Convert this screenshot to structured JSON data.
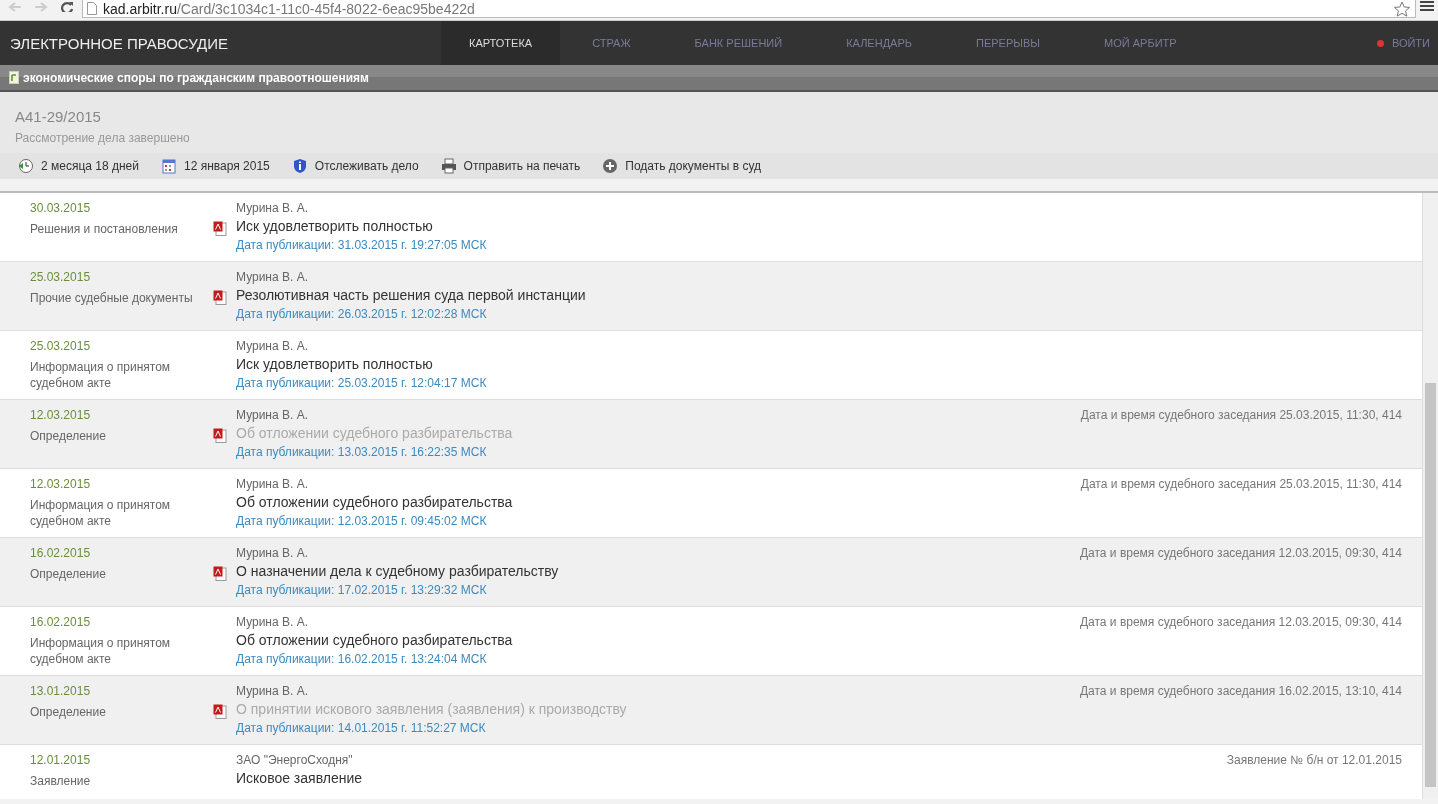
{
  "browser": {
    "url_host": "kad.arbitr.ru",
    "url_path": "/Card/3c1034c1-11c0-45f4-8022-6eac95be422d"
  },
  "site": {
    "title": "ЭЛЕКТРОННОЕ ПРАВОСУДИЕ",
    "nav": [
      {
        "label": "КАРТОТЕКА",
        "selected": true
      },
      {
        "label": "СТРАЖ",
        "selected": false
      },
      {
        "label": "БАНК РЕШЕНИЙ",
        "selected": false
      },
      {
        "label": "КАЛЕНДАРЬ",
        "selected": false
      },
      {
        "label": "ПЕРЕРЫВЫ",
        "selected": false
      },
      {
        "label": "МОЙ АРБИТР",
        "selected": false
      }
    ],
    "login": "ВОЙТИ"
  },
  "category": "экономические споры по гражданским правоотношениям",
  "case": {
    "number": "А41-29/2015",
    "status": "Рассмотрение дела завершено",
    "actions": [
      {
        "kind": "duration",
        "label": "2 месяца 18 дней"
      },
      {
        "kind": "date",
        "label": "12 января 2015"
      },
      {
        "kind": "track",
        "label": "Отслеживать дело"
      },
      {
        "kind": "print",
        "label": "Отправить на печать"
      },
      {
        "kind": "submit",
        "label": "Подать документы в суд"
      }
    ]
  },
  "documents": [
    {
      "date": "30.03.2015",
      "type": "Решения и постановления",
      "author": "Мурина В. А.",
      "title": "Иск удовлетворить полностью",
      "published": "Дата публикации: 31.03.2015 г. 19:27:05 МСК",
      "pdf": true,
      "dimmed": false
    },
    {
      "date": "25.03.2015",
      "type": "Прочие судебные документы",
      "author": "Мурина В. А.",
      "title": "Резолютивная часть решения суда первой инстанции",
      "published": "Дата публикации: 26.03.2015 г. 12:02:28 МСК",
      "pdf": true,
      "dimmed": false
    },
    {
      "date": "25.03.2015",
      "type": "Информация о принятом судебном акте",
      "author": "Мурина В. А.",
      "title": "Иск удовлетворить полностью",
      "published": "Дата публикации: 25.03.2015 г. 12:04:17 МСК",
      "pdf": false,
      "dimmed": false
    },
    {
      "date": "12.03.2015",
      "type": "Определение",
      "author": "Мурина В. А.",
      "title": "Об отложении судебного разбирательства",
      "published": "Дата публикации: 13.03.2015 г. 16:22:35 МСК",
      "pdf": true,
      "dimmed": true,
      "note": "Дата и время судебного заседания 25.03.2015, 11:30, 414"
    },
    {
      "date": "12.03.2015",
      "type": "Информация о принятом судебном акте",
      "author": "Мурина В. А.",
      "title": "Об отложении судебного разбирательства",
      "published": "Дата публикации: 12.03.2015 г. 09:45:02 МСК",
      "pdf": false,
      "dimmed": false,
      "note": "Дата и время судебного заседания 25.03.2015, 11:30, 414"
    },
    {
      "date": "16.02.2015",
      "type": "Определение",
      "author": "Мурина В. А.",
      "title": "О назначении дела к судебному разбирательству",
      "published": "Дата публикации: 17.02.2015 г. 13:29:32 МСК",
      "pdf": true,
      "dimmed": false,
      "note": "Дата и время судебного заседания 12.03.2015, 09:30, 414"
    },
    {
      "date": "16.02.2015",
      "type": "Информация о принятом судебном акте",
      "author": "Мурина В. А.",
      "title": "Об отложении судебного разбирательства",
      "published": "Дата публикации: 16.02.2015 г. 13:24:04 МСК",
      "pdf": false,
      "dimmed": false,
      "note": "Дата и время судебного заседания 12.03.2015, 09:30, 414"
    },
    {
      "date": "13.01.2015",
      "type": "Определение",
      "author": "Мурина В. А.",
      "title": "О принятии искового заявления (заявления) к производству",
      "published": "Дата публикации: 14.01.2015 г. 11:52:27 МСК",
      "pdf": true,
      "dimmed": true,
      "note": "Дата и время судебного заседания 16.02.2015, 13:10, 414"
    },
    {
      "date": "12.01.2015",
      "type": "Заявление",
      "author": "ЗАО \"ЭнергоСходня\"",
      "title": "Исковое заявление",
      "pdf": false,
      "dimmed": false,
      "note": "Заявление № б/н от 12.01.2015"
    }
  ]
}
